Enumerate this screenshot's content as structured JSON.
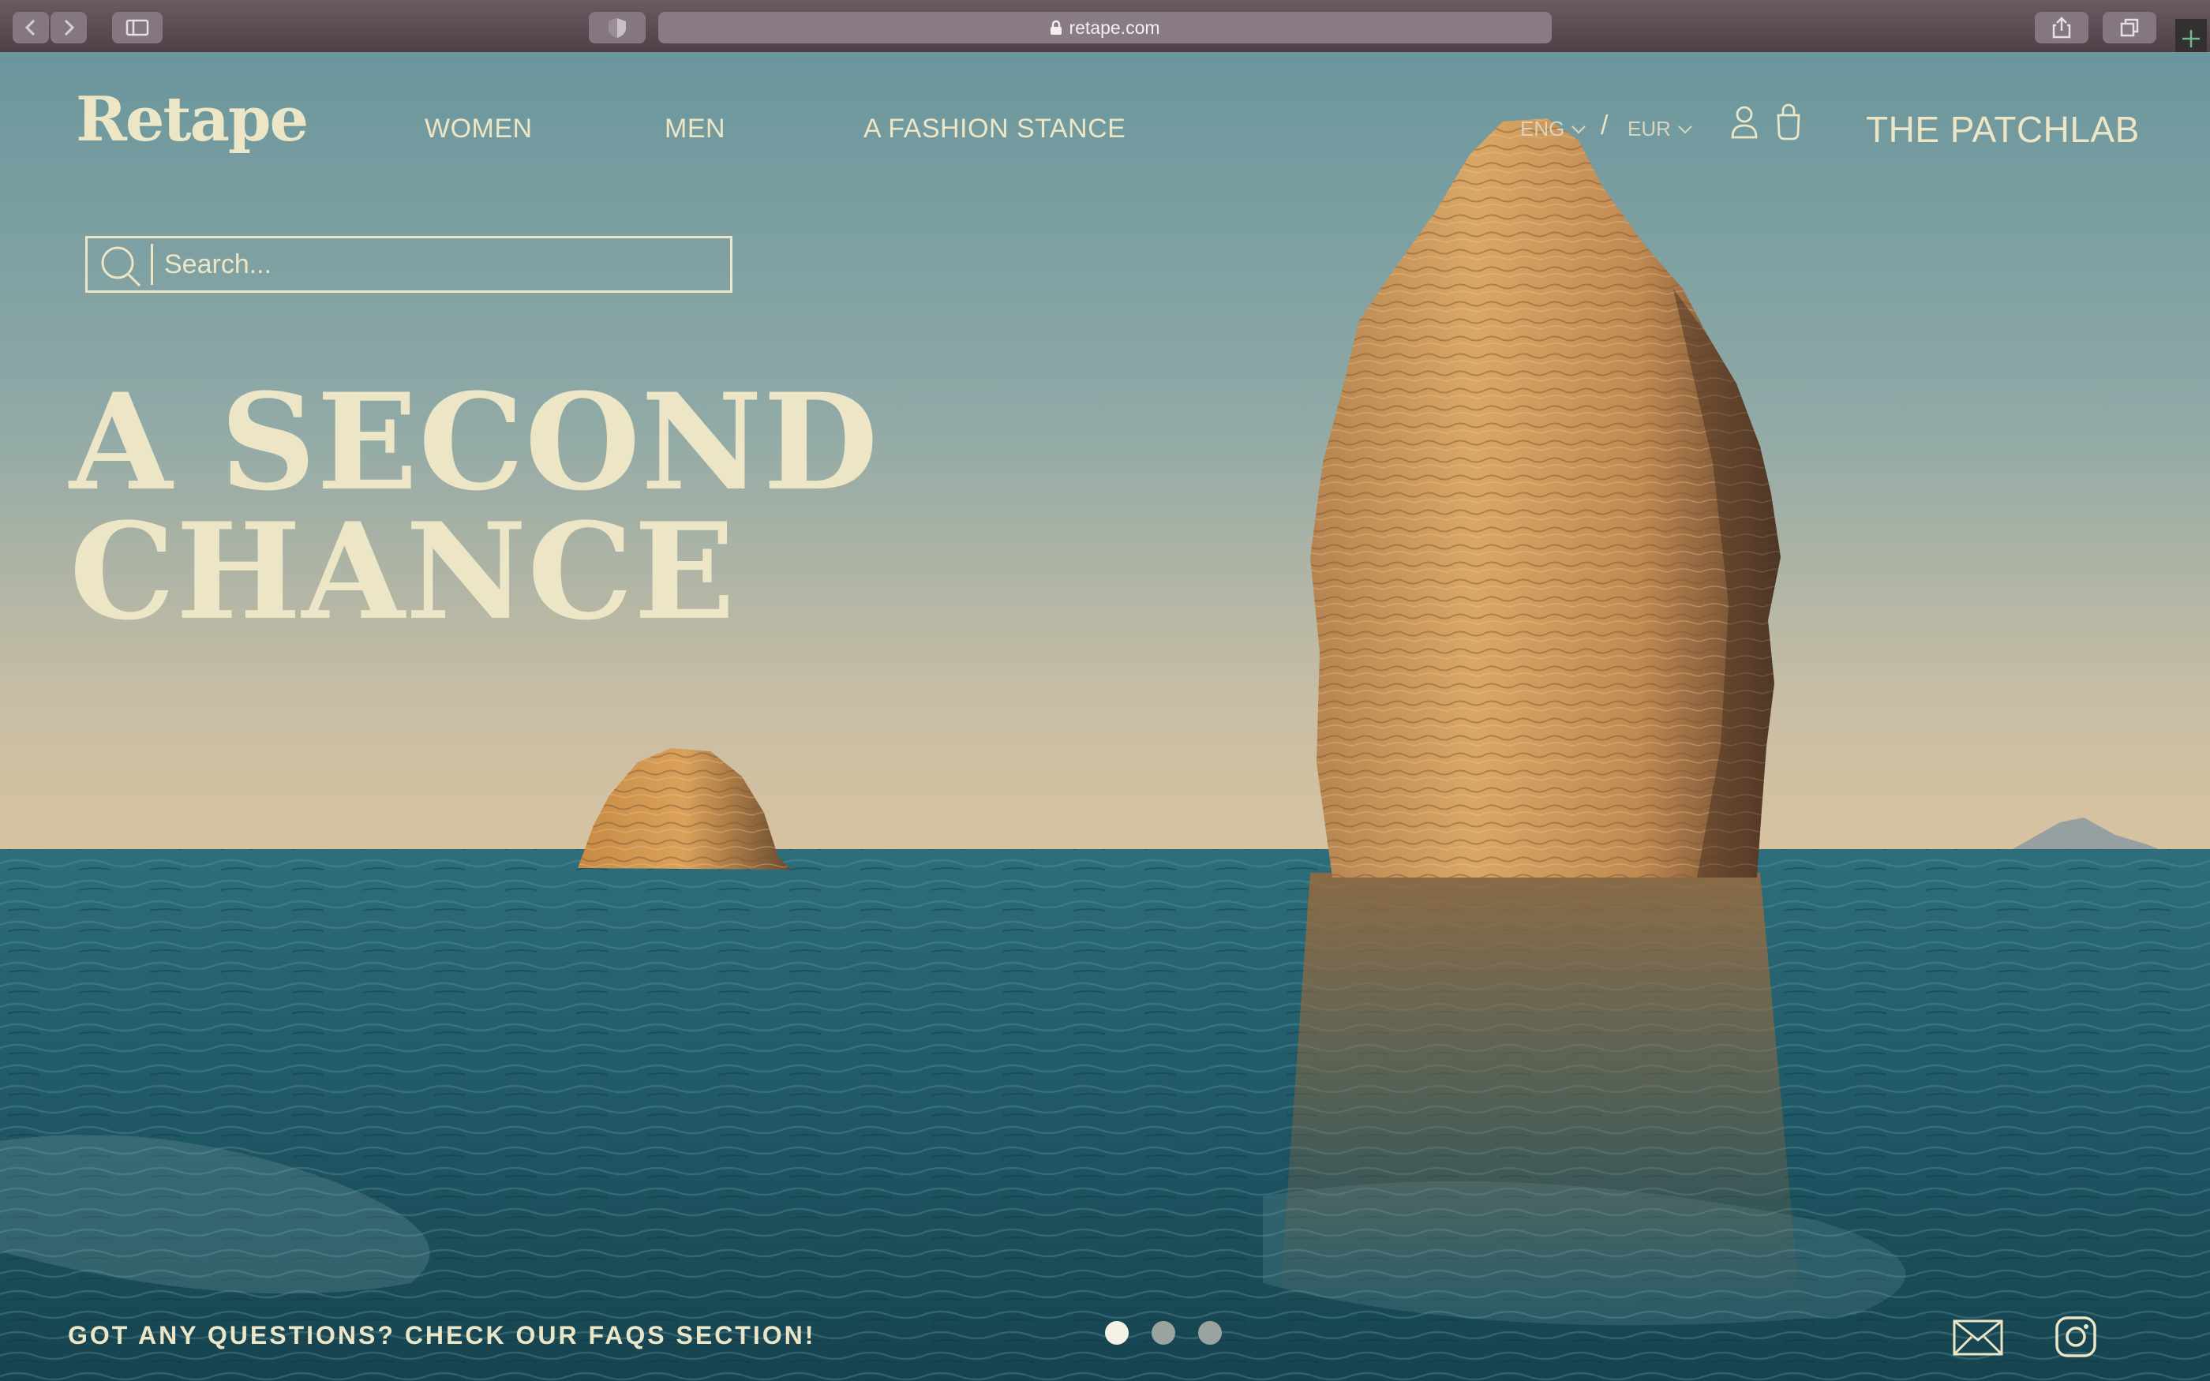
{
  "browser": {
    "url": "retape.com"
  },
  "header": {
    "logo": "Retape",
    "nav": [
      "WOMEN",
      "MEN",
      "A FASHION STANCE"
    ],
    "language": "ENG",
    "separator": "/",
    "currency": "EUR",
    "brand_link": "THE PATCHLAB"
  },
  "search": {
    "placeholder": "Search..."
  },
  "hero": {
    "headline_line1": "A SECOND",
    "headline_line2": "CHANCE",
    "carousel": {
      "slides": 3,
      "active": 1
    }
  },
  "footer": {
    "faq_text": "GOT ANY QUESTIONS? CHECK OUR FAQS SECTION!"
  },
  "icons": [
    "back-arrow-icon",
    "forward-arrow-icon",
    "sidebar-icon",
    "shield-icon",
    "lock-icon",
    "share-icon",
    "tabs-icon",
    "new-tab-icon",
    "search-icon",
    "user-icon",
    "shopping-bag-icon",
    "mail-icon",
    "instagram-icon"
  ],
  "colors": {
    "text_cream": "#ece6c6",
    "sky_top": "#6f9aa0",
    "sky_bottom": "#d1bfa0",
    "sea": "#1f5566",
    "rock": "#c98f4b"
  }
}
